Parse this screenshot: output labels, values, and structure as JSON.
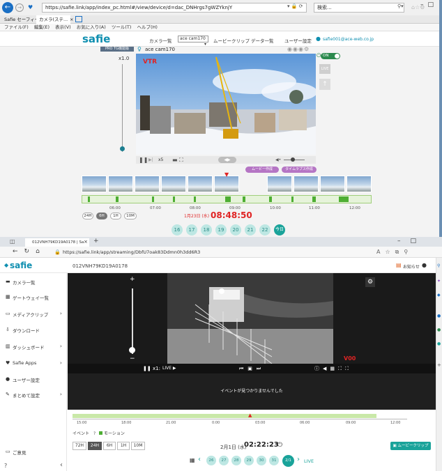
{
  "ie": {
    "url": "https://safie.link/app/index_pc.html#/view/device/d=dac_DNHrgs7gWZYknjY",
    "search_placeholder": "検索...",
    "tabs": [
      "Safie セーフィー",
      "カメラ(ステ...",
      "×"
    ],
    "menu": [
      "ファイル(F)",
      "編集(E)",
      "表示(V)",
      "お気に入り(A)",
      "ツール(T)",
      "ヘルプ(H)"
    ]
  },
  "s1": {
    "logo": "safie",
    "nav": [
      "カメラ一覧",
      "ムービークリップ",
      "データ一覧",
      "ユーザー設定"
    ],
    "camera_select": "ace cam170",
    "email": "safie001@ace-web.co.jp",
    "pro_badge": "PRO TG機能版",
    "camera_name": "ace cam170",
    "zoom": "x1.0",
    "vtr": "VTR",
    "speed": "x5",
    "on_label": "ON",
    "live_label": "LIVE",
    "movie_clip_btn": "ムービー作成",
    "timelapse_btn": "タイムラプス作成",
    "ticks": [
      "06:00",
      "07:00",
      "08:00",
      "09:00",
      "10:00",
      "11:00",
      "12:00"
    ],
    "ranges": [
      "24H",
      "6H",
      "1H",
      "10M"
    ],
    "date": "1月23日 (水)",
    "time": "08:48:50",
    "days": [
      "16",
      "17",
      "18",
      "19",
      "20",
      "21",
      "22",
      "今日"
    ]
  },
  "edge": {
    "tab_title": "012VNH79KD19A0178 | Sa",
    "url": "https://safie.link/app/streaming/DbfU7oak83Ddmn0h3dd6R3"
  },
  "s2": {
    "logo": "safie",
    "device_id": "012VNH79KD19A0178",
    "notifications": "お知らせ",
    "sidebar": [
      "カメラ一覧",
      "ゲートウェイ一覧",
      "メディアクリップ",
      "ダウンロード",
      "ダッシュボード",
      "Safie Apps",
      "ユーザー設定",
      "まとめて設定"
    ],
    "sidebar_bottom": "ご意見",
    "zoom_plus": "+",
    "zoom_minus": "−",
    "speed": "x1:",
    "live": "LIVE ▶",
    "v00": "V00",
    "no_events": "イベントが見つかりませんでした",
    "ticks": [
      "15:00",
      "18:00",
      "21:00",
      "0:00",
      "03:00",
      "06:00",
      "09:00",
      "12:00"
    ],
    "event_label": "イベント",
    "motion_label": "モーション",
    "ranges": [
      "72H",
      "24H",
      "6H",
      "1H",
      "10M"
    ],
    "date": "2月1日 (水)",
    "time": "02:22:23",
    "movie_clip_btn": "ムービークリップ",
    "days": [
      "26",
      "27",
      "28",
      "29",
      "30",
      "31",
      "2/1"
    ],
    "live_link": "LIVE"
  },
  "colors": {
    "brand": "#0f8fb0",
    "accent_red": "#e02424",
    "teal": "#1aa39a",
    "green": "#4eae33",
    "purple": "#b575c4"
  }
}
